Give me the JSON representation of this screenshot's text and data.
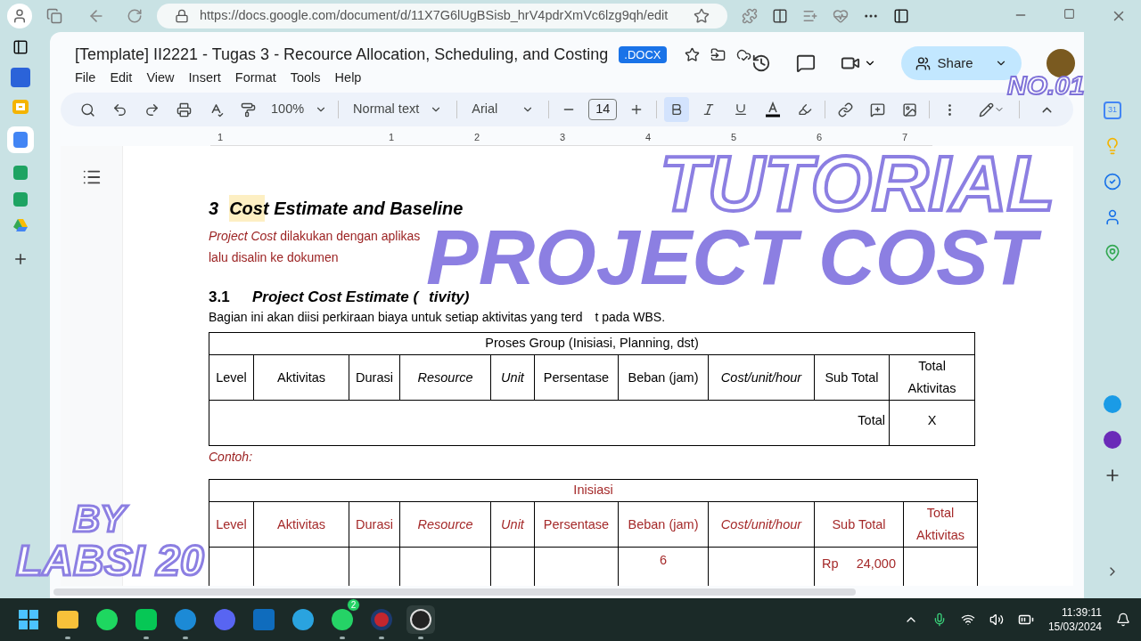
{
  "browser": {
    "url": "https://docs.google.com/document/d/11X7G6lUgBSisb_hrV4pdrXmVc6lzg9qh/edit"
  },
  "document": {
    "title": "[Template] II2221 - Tugas 3 - Recource Allocation, Scheduling, and Costing",
    "badge": ".DOCX",
    "menus": [
      "File",
      "Edit",
      "View",
      "Insert",
      "Format",
      "Tools",
      "Help"
    ],
    "share": "Share"
  },
  "toolbar": {
    "zoom": "100%",
    "style": "Normal text",
    "font": "Arial",
    "size": "14",
    "bold": true,
    "italic": false,
    "underline": false
  },
  "ruler": [
    "1",
    "1",
    "2",
    "3",
    "4",
    "5",
    "6",
    "7"
  ],
  "content": {
    "heading_number": "3",
    "heading": "Cost Estimate and Baseline",
    "paragraph_fragments": [
      "*Project Cost* dilakukan dengan aplikas"
    ],
    "paragraph_line_2": "lalu disalin ke dokumen",
    "subheading_number": "3.1",
    "subheading_fragments": [
      "Project Cost Estimate (",
      "tivity)"
    ],
    "body_fragments": [
      "Bagian ini akan diisi perkiraan biaya untuk setiap aktivitas yang terd",
      "t pada WBS."
    ],
    "example_label": "Contoh:"
  },
  "tables": [
    {
      "kind": "template",
      "caption": "Proses Group (Inisiasi, Planning, dst)",
      "columns": [
        {
          "label": "Level",
          "italic": false
        },
        {
          "label": "Aktivitas",
          "italic": false
        },
        {
          "label": "Durasi",
          "italic": false
        },
        {
          "label": "Resource",
          "italic": true
        },
        {
          "label": "Unit",
          "italic": true
        },
        {
          "label": "Persentase",
          "italic": false
        },
        {
          "label": "Beban (jam)",
          "italic": false
        },
        {
          "label": "Cost/unit/hour",
          "italic": true
        },
        {
          "label": "Sub Total",
          "italic": false
        },
        {
          "label": "Total Aktivitas",
          "italic": false
        }
      ],
      "total_label": "Total",
      "total_value": "X"
    },
    {
      "kind": "example",
      "caption": "Inisiasi",
      "columns": [
        {
          "label": "Level",
          "italic": false
        },
        {
          "label": "Aktivitas",
          "italic": false
        },
        {
          "label": "Durasi",
          "italic": false
        },
        {
          "label": "Resource",
          "italic": true
        },
        {
          "label": "Unit",
          "italic": true
        },
        {
          "label": "Persentase",
          "italic": false
        },
        {
          "label": "Beban (jam)",
          "italic": false
        },
        {
          "label": "Cost/unit/hour",
          "italic": true
        },
        {
          "label": "Sub Total",
          "italic": false
        },
        {
          "label": "Total Aktivitas",
          "italic": false
        }
      ],
      "row": {
        "beban": "6",
        "currency": "Rp",
        "subtotal": "24,000"
      }
    }
  ],
  "overlay": {
    "title_line_1": "TUTORIAL",
    "title_line_2": "PROJECT COST",
    "number": "NO.01",
    "by": "BY",
    "author": "LABSI 20"
  },
  "right_sidebar": {
    "calendar_day": "31"
  },
  "taskbar": {
    "whatsapp_badge": "2",
    "time": "11:39:11",
    "date": "15/03/2024"
  }
}
